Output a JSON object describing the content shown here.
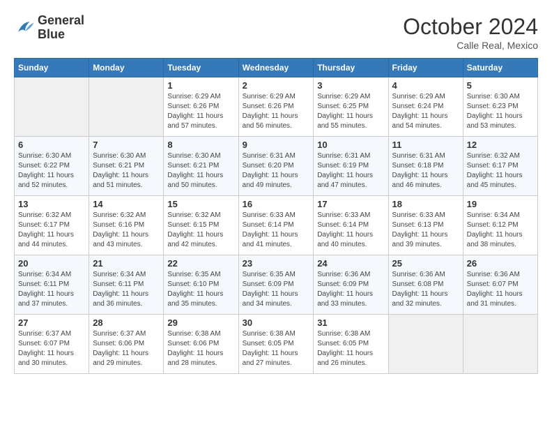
{
  "header": {
    "logo_line1": "General",
    "logo_line2": "Blue",
    "month": "October 2024",
    "location": "Calle Real, Mexico"
  },
  "weekdays": [
    "Sunday",
    "Monday",
    "Tuesday",
    "Wednesday",
    "Thursday",
    "Friday",
    "Saturday"
  ],
  "weeks": [
    [
      {
        "day": "",
        "empty": true
      },
      {
        "day": "",
        "empty": true
      },
      {
        "day": "1",
        "sunrise": "6:29 AM",
        "sunset": "6:26 PM",
        "daylight": "11 hours and 57 minutes."
      },
      {
        "day": "2",
        "sunrise": "6:29 AM",
        "sunset": "6:26 PM",
        "daylight": "11 hours and 56 minutes."
      },
      {
        "day": "3",
        "sunrise": "6:29 AM",
        "sunset": "6:25 PM",
        "daylight": "11 hours and 55 minutes."
      },
      {
        "day": "4",
        "sunrise": "6:29 AM",
        "sunset": "6:24 PM",
        "daylight": "11 hours and 54 minutes."
      },
      {
        "day": "5",
        "sunrise": "6:30 AM",
        "sunset": "6:23 PM",
        "daylight": "11 hours and 53 minutes."
      }
    ],
    [
      {
        "day": "6",
        "sunrise": "6:30 AM",
        "sunset": "6:22 PM",
        "daylight": "11 hours and 52 minutes."
      },
      {
        "day": "7",
        "sunrise": "6:30 AM",
        "sunset": "6:21 PM",
        "daylight": "11 hours and 51 minutes."
      },
      {
        "day": "8",
        "sunrise": "6:30 AM",
        "sunset": "6:21 PM",
        "daylight": "11 hours and 50 minutes."
      },
      {
        "day": "9",
        "sunrise": "6:31 AM",
        "sunset": "6:20 PM",
        "daylight": "11 hours and 49 minutes."
      },
      {
        "day": "10",
        "sunrise": "6:31 AM",
        "sunset": "6:19 PM",
        "daylight": "11 hours and 47 minutes."
      },
      {
        "day": "11",
        "sunrise": "6:31 AM",
        "sunset": "6:18 PM",
        "daylight": "11 hours and 46 minutes."
      },
      {
        "day": "12",
        "sunrise": "6:32 AM",
        "sunset": "6:17 PM",
        "daylight": "11 hours and 45 minutes."
      }
    ],
    [
      {
        "day": "13",
        "sunrise": "6:32 AM",
        "sunset": "6:17 PM",
        "daylight": "11 hours and 44 minutes."
      },
      {
        "day": "14",
        "sunrise": "6:32 AM",
        "sunset": "6:16 PM",
        "daylight": "11 hours and 43 minutes."
      },
      {
        "day": "15",
        "sunrise": "6:32 AM",
        "sunset": "6:15 PM",
        "daylight": "11 hours and 42 minutes."
      },
      {
        "day": "16",
        "sunrise": "6:33 AM",
        "sunset": "6:14 PM",
        "daylight": "11 hours and 41 minutes."
      },
      {
        "day": "17",
        "sunrise": "6:33 AM",
        "sunset": "6:14 PM",
        "daylight": "11 hours and 40 minutes."
      },
      {
        "day": "18",
        "sunrise": "6:33 AM",
        "sunset": "6:13 PM",
        "daylight": "11 hours and 39 minutes."
      },
      {
        "day": "19",
        "sunrise": "6:34 AM",
        "sunset": "6:12 PM",
        "daylight": "11 hours and 38 minutes."
      }
    ],
    [
      {
        "day": "20",
        "sunrise": "6:34 AM",
        "sunset": "6:11 PM",
        "daylight": "11 hours and 37 minutes."
      },
      {
        "day": "21",
        "sunrise": "6:34 AM",
        "sunset": "6:11 PM",
        "daylight": "11 hours and 36 minutes."
      },
      {
        "day": "22",
        "sunrise": "6:35 AM",
        "sunset": "6:10 PM",
        "daylight": "11 hours and 35 minutes."
      },
      {
        "day": "23",
        "sunrise": "6:35 AM",
        "sunset": "6:09 PM",
        "daylight": "11 hours and 34 minutes."
      },
      {
        "day": "24",
        "sunrise": "6:36 AM",
        "sunset": "6:09 PM",
        "daylight": "11 hours and 33 minutes."
      },
      {
        "day": "25",
        "sunrise": "6:36 AM",
        "sunset": "6:08 PM",
        "daylight": "11 hours and 32 minutes."
      },
      {
        "day": "26",
        "sunrise": "6:36 AM",
        "sunset": "6:07 PM",
        "daylight": "11 hours and 31 minutes."
      }
    ],
    [
      {
        "day": "27",
        "sunrise": "6:37 AM",
        "sunset": "6:07 PM",
        "daylight": "11 hours and 30 minutes."
      },
      {
        "day": "28",
        "sunrise": "6:37 AM",
        "sunset": "6:06 PM",
        "daylight": "11 hours and 29 minutes."
      },
      {
        "day": "29",
        "sunrise": "6:38 AM",
        "sunset": "6:06 PM",
        "daylight": "11 hours and 28 minutes."
      },
      {
        "day": "30",
        "sunrise": "6:38 AM",
        "sunset": "6:05 PM",
        "daylight": "11 hours and 27 minutes."
      },
      {
        "day": "31",
        "sunrise": "6:38 AM",
        "sunset": "6:05 PM",
        "daylight": "11 hours and 26 minutes."
      },
      {
        "day": "",
        "empty": true
      },
      {
        "day": "",
        "empty": true
      }
    ]
  ]
}
